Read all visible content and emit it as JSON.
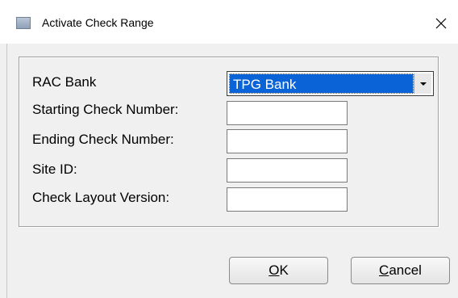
{
  "window": {
    "title": "Activate Check Range",
    "close_symbol": "✕"
  },
  "form": {
    "bank_label": "RAC Bank",
    "bank_selected": "TPG Bank",
    "starting_label": "Starting Check Number:",
    "starting_value": "",
    "ending_label": "Ending Check Number:",
    "ending_value": "",
    "site_label": "Site ID:",
    "site_value": "",
    "layout_label": "Check Layout Version:",
    "layout_value": ""
  },
  "buttons": {
    "ok_accel": "O",
    "ok_rest": "K",
    "cancel_accel": "C",
    "cancel_rest": "ancel"
  },
  "colors": {
    "selection": "#0a64d8",
    "dialog_background": "#f0f0f0"
  }
}
